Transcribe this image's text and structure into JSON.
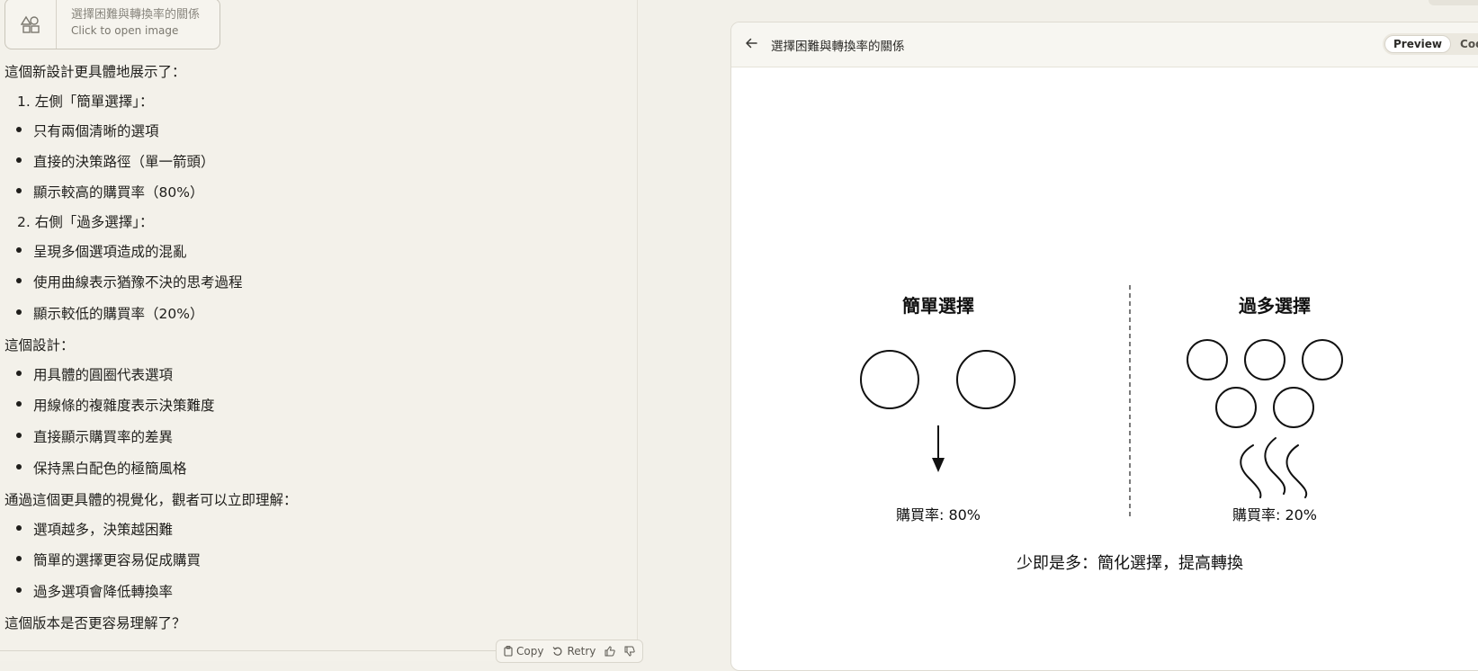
{
  "artifact_card": {
    "title": "選擇困難與轉換率的關係",
    "subtitle": "Click to open image",
    "icon": "shapes-icon"
  },
  "message": {
    "intro": "這個新設計更具體地展示了：",
    "section1": {
      "heading": "1. 左側「簡單選擇」：",
      "bullets": [
        "只有兩個清晰的選項",
        "直接的決策路徑（單一箭頭）",
        "顯示較高的購買率（80%）"
      ]
    },
    "section2": {
      "heading": "2. 右側「過多選擇」：",
      "bullets": [
        "呈現多個選項造成的混亂",
        "使用曲線表示猶豫不決的思考過程",
        "顯示較低的購買率（20%）"
      ]
    },
    "design_intro": "這個設計：",
    "design_bullets": [
      "用具體的圓圈代表選項",
      "用線條的複雜度表示決策難度",
      "直接顯示購買率的差異",
      "保持黑白配色的極簡風格"
    ],
    "understand_intro": "通過這個更具體的視覺化，觀者可以立即理解：",
    "understand_bullets": [
      "選項越多，決策越困難",
      "簡單的選擇更容易促成購買",
      "過多選項會降低轉換率"
    ],
    "closing": "這個版本是否更容易理解了？"
  },
  "actions": {
    "copy": "Copy",
    "retry": "Retry",
    "thumbs_up_icon": "thumbs-up-icon",
    "thumbs_down_icon": "thumbs-down-icon"
  },
  "preview": {
    "title": "選擇困難與轉換率的關係",
    "tab_preview": "Preview",
    "tab_code": "Code",
    "active_tab": "Preview"
  },
  "illustration": {
    "left_title": "簡單選擇",
    "left_rate": "購買率: 80%",
    "right_title": "過多選擇",
    "right_rate": "購買率: 20%",
    "caption": "少即是多：簡化選擇，提高轉換",
    "left_option_count": 2,
    "right_option_count": 5
  },
  "colors": {
    "page_bg": "#f2f0e9",
    "preview_bg": "#ffffff",
    "ink": "#111111"
  }
}
